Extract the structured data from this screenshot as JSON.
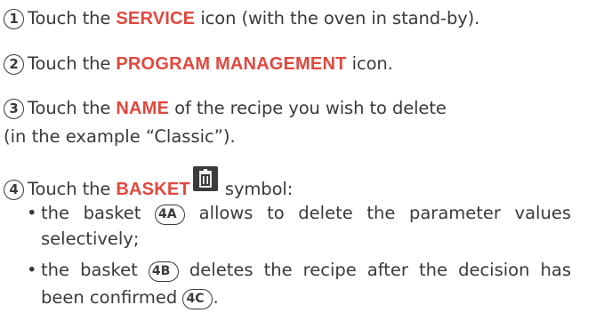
{
  "steps": [
    {
      "number": "1",
      "before": "Touch the ",
      "keyword": "SERVICE",
      "after": " icon (with the oven in stand-by)."
    },
    {
      "number": "2",
      "before": "Touch the ",
      "keyword": "PROGRAM MANAGEMENT",
      "after": " icon."
    },
    {
      "number": "3",
      "before": "Touch the ",
      "keyword": "NAME",
      "after": " of the recipe you wish to delete",
      "continuation": "(in the example “Classic”)."
    },
    {
      "number": "4",
      "before": "Touch the ",
      "keyword": "BASKET",
      "icon": "trash-icon",
      "after": " symbol:"
    }
  ],
  "bullets": [
    {
      "marker": "•",
      "line1_before": "the basket ",
      "tag": "4A",
      "line1_after": " allows to delete the parameter values",
      "line2": "selectively;"
    },
    {
      "marker": "•",
      "line1": "the basket ",
      "tag": "4B",
      "line1_after": " deletes the recipe after the decision has",
      "line2_before": "been confirmed ",
      "tag2": "4C",
      "line2_after": "."
    }
  ],
  "colors": {
    "keyword": "#e0483e",
    "text": "#3a3a3a",
    "icon_bg": "#3c3c3c"
  }
}
